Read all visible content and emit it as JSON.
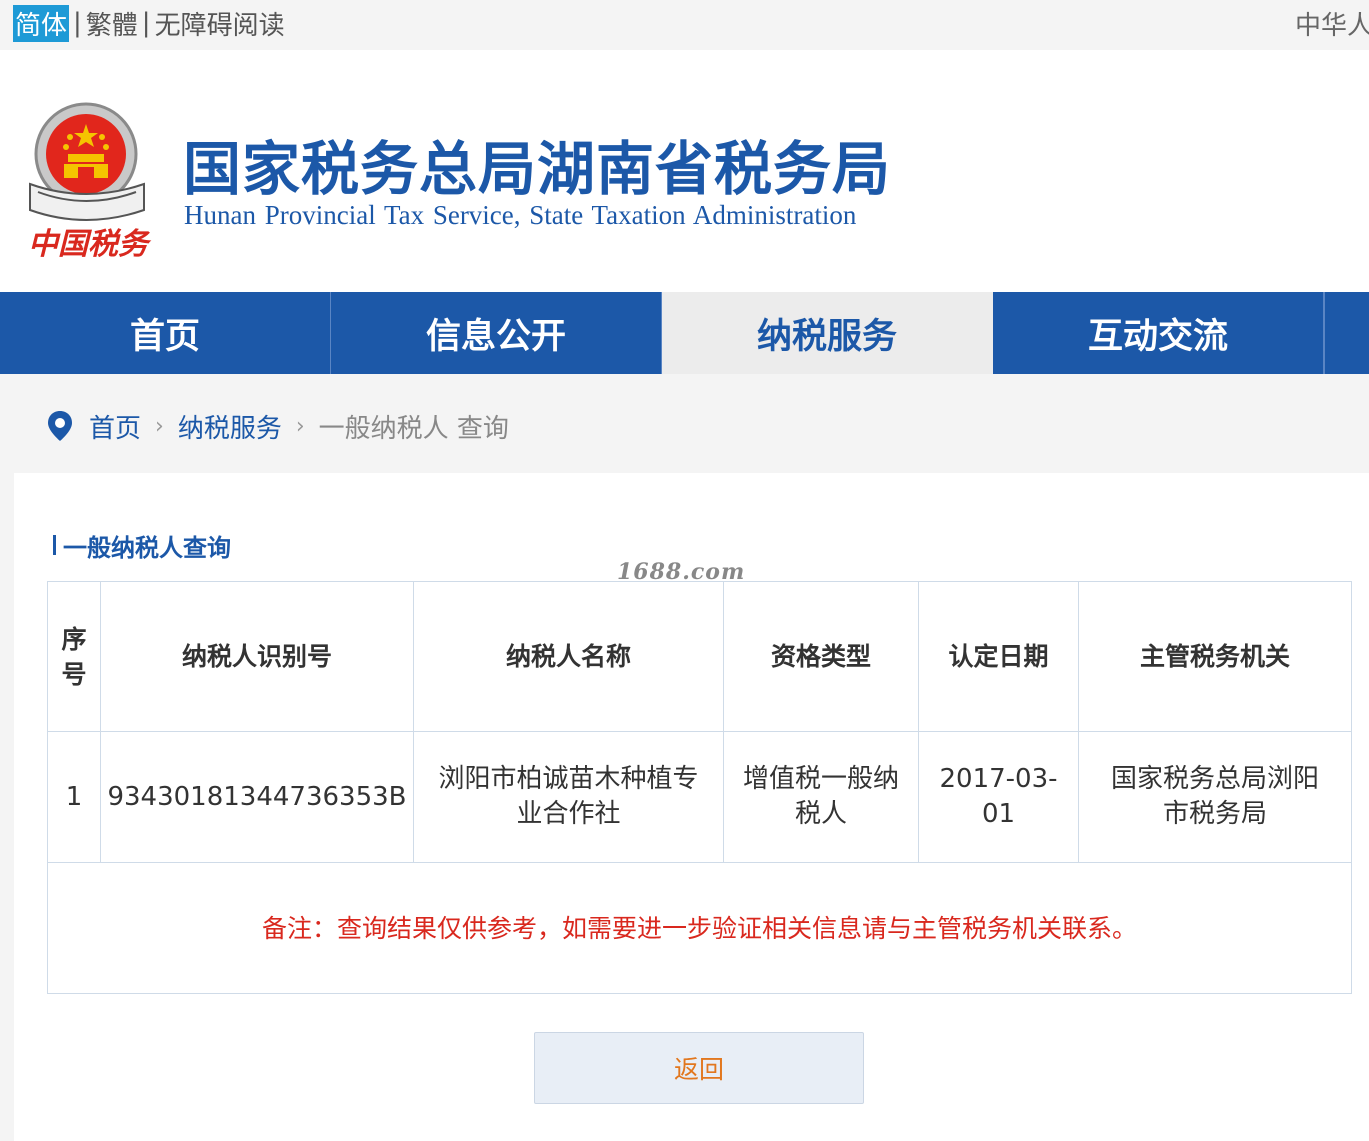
{
  "topbar": {
    "simplified": "简体",
    "traditional": "繁體",
    "accessibility": "无障碍阅读",
    "right_text": "中华人"
  },
  "header": {
    "title": "国家税务总局湖南省税务局",
    "subtitle": "Hunan Provincial  Tax Service,  State Taxation Administration",
    "logo_caption": "中国税务"
  },
  "nav": {
    "items": [
      {
        "label": "首页"
      },
      {
        "label": "信息公开"
      },
      {
        "label": "纳税服务"
      },
      {
        "label": "互动交流"
      }
    ],
    "active_index": 2
  },
  "breadcrumb": {
    "home": "首页",
    "section": "纳税服务",
    "current": "一般纳税人 查询"
  },
  "section": {
    "title": "一般纳税人查询",
    "watermark": "1688.com"
  },
  "table": {
    "headers": [
      "序号",
      "纳税人识别号",
      "纳税人名称",
      "资格类型",
      "认定日期",
      "主管税务机关"
    ],
    "rows": [
      [
        "1",
        "93430181344736353B",
        "浏阳市柏诚苗木种植专业合作社",
        "增值税一般纳税人",
        "2017-03-01",
        "国家税务总局浏阳市税务局"
      ]
    ],
    "note": "备注：查询结果仅供参考，如需要进一步验证相关信息请与主管税务机关联系。"
  },
  "actions": {
    "back_label": "返回"
  },
  "colors": {
    "brand_blue": "#1c58a8",
    "note_red": "#d9281e",
    "back_orange": "#e2771e",
    "lang_selected": "#1e9ad6"
  }
}
